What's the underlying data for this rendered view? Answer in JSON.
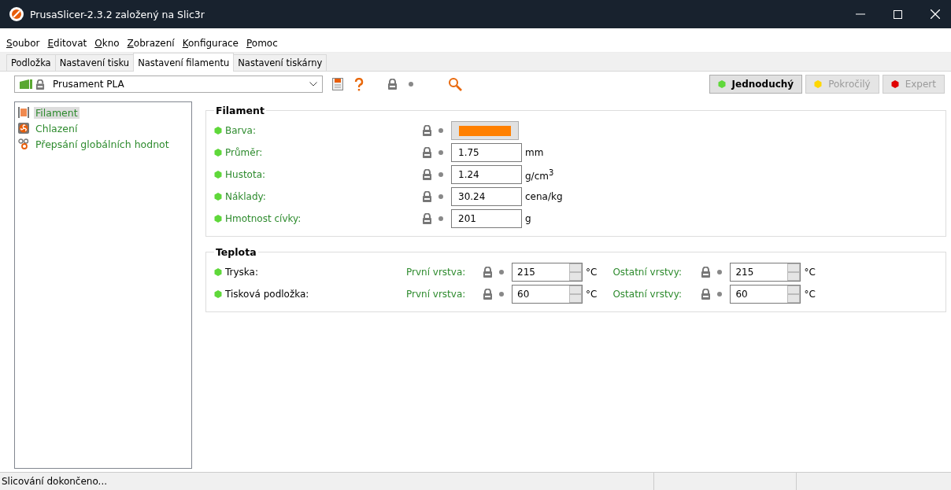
{
  "window": {
    "title": "PrusaSlicer-2.3.2 založený na Slic3r"
  },
  "menu": [
    "Soubor",
    "Editovat",
    "Okno",
    "Zobrazení",
    "Konfigurace",
    "Pomoc"
  ],
  "tabs": [
    {
      "label": "Podložka",
      "selected": false
    },
    {
      "label": "Nastavení tisku",
      "selected": false
    },
    {
      "label": "Nastavení filamentu",
      "selected": true
    },
    {
      "label": "Nastavení tiskárny",
      "selected": false
    }
  ],
  "preset": {
    "value": "Prusament PLA"
  },
  "modes": [
    {
      "label": "Jednoduchý",
      "selected": true,
      "color": "#5fd83a"
    },
    {
      "label": "Pokročilý",
      "selected": false,
      "color": "#ffd700"
    },
    {
      "label": "Expert",
      "selected": false,
      "color": "#e00000"
    }
  ],
  "sidebar": {
    "items": [
      {
        "label": "Filament",
        "kind": "filament",
        "selected": true
      },
      {
        "label": "Chlazení",
        "kind": "cooling",
        "selected": false
      },
      {
        "label": "Přepsání globálních hodnot",
        "kind": "overrides",
        "selected": false
      }
    ]
  },
  "groups": [
    {
      "title": "Filament",
      "rows": [
        {
          "kind": "swatch",
          "label": "Barva:",
          "color": "#ff8000"
        },
        {
          "kind": "text",
          "label": "Průměr:",
          "value": "1.75",
          "unit": "mm"
        },
        {
          "kind": "text",
          "label": "Hustota:",
          "value": "1.24",
          "unit": "g/cm$^{3}$"
        },
        {
          "kind": "text",
          "label": "Náklady:",
          "value": "30.24",
          "unit": "cena/kg"
        },
        {
          "kind": "text",
          "label": "Hmotnost cívky:",
          "value": "201",
          "unit": "g"
        }
      ]
    },
    {
      "title": "Teplota",
      "rows": [
        {
          "kind": "pair",
          "label": "Tryska:",
          "first_label": "První vrstva:",
          "first_value": "215",
          "first_unit": "°C",
          "other_label": "Ostatní vrstvy:",
          "other_value": "215",
          "other_unit": "°C"
        },
        {
          "kind": "pair",
          "label": "Tisková podložka:",
          "first_label": "První vrstva:",
          "first_value": "60",
          "first_unit": "°C",
          "other_label": "Ostatní vrstvy:",
          "other_value": "60",
          "other_unit": "°C"
        }
      ]
    }
  ],
  "status_bar": {
    "text": "Slicování dokončeno..."
  }
}
